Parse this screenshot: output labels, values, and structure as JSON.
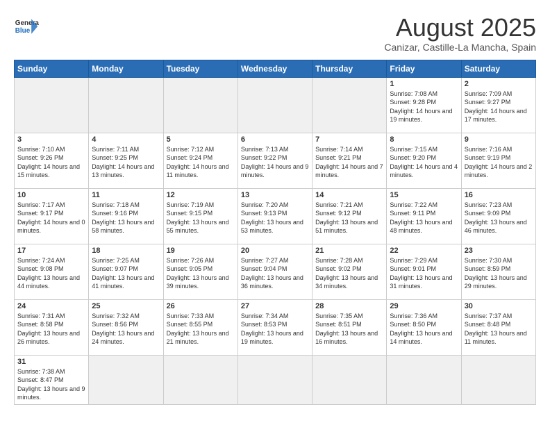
{
  "logo": {
    "text_general": "General",
    "text_blue": "Blue"
  },
  "calendar": {
    "title": "August 2025",
    "subtitle": "Canizar, Castille-La Mancha, Spain",
    "headers": [
      "Sunday",
      "Monday",
      "Tuesday",
      "Wednesday",
      "Thursday",
      "Friday",
      "Saturday"
    ],
    "weeks": [
      [
        {
          "day": "",
          "info": "",
          "empty": true
        },
        {
          "day": "",
          "info": "",
          "empty": true
        },
        {
          "day": "",
          "info": "",
          "empty": true
        },
        {
          "day": "",
          "info": "",
          "empty": true
        },
        {
          "day": "",
          "info": "",
          "empty": true
        },
        {
          "day": "1",
          "info": "Sunrise: 7:08 AM\nSunset: 9:28 PM\nDaylight: 14 hours and 19 minutes."
        },
        {
          "day": "2",
          "info": "Sunrise: 7:09 AM\nSunset: 9:27 PM\nDaylight: 14 hours and 17 minutes."
        }
      ],
      [
        {
          "day": "3",
          "info": "Sunrise: 7:10 AM\nSunset: 9:26 PM\nDaylight: 14 hours and 15 minutes."
        },
        {
          "day": "4",
          "info": "Sunrise: 7:11 AM\nSunset: 9:25 PM\nDaylight: 14 hours and 13 minutes."
        },
        {
          "day": "5",
          "info": "Sunrise: 7:12 AM\nSunset: 9:24 PM\nDaylight: 14 hours and 11 minutes."
        },
        {
          "day": "6",
          "info": "Sunrise: 7:13 AM\nSunset: 9:22 PM\nDaylight: 14 hours and 9 minutes."
        },
        {
          "day": "7",
          "info": "Sunrise: 7:14 AM\nSunset: 9:21 PM\nDaylight: 14 hours and 7 minutes."
        },
        {
          "day": "8",
          "info": "Sunrise: 7:15 AM\nSunset: 9:20 PM\nDaylight: 14 hours and 4 minutes."
        },
        {
          "day": "9",
          "info": "Sunrise: 7:16 AM\nSunset: 9:19 PM\nDaylight: 14 hours and 2 minutes."
        }
      ],
      [
        {
          "day": "10",
          "info": "Sunrise: 7:17 AM\nSunset: 9:17 PM\nDaylight: 14 hours and 0 minutes."
        },
        {
          "day": "11",
          "info": "Sunrise: 7:18 AM\nSunset: 9:16 PM\nDaylight: 13 hours and 58 minutes."
        },
        {
          "day": "12",
          "info": "Sunrise: 7:19 AM\nSunset: 9:15 PM\nDaylight: 13 hours and 55 minutes."
        },
        {
          "day": "13",
          "info": "Sunrise: 7:20 AM\nSunset: 9:13 PM\nDaylight: 13 hours and 53 minutes."
        },
        {
          "day": "14",
          "info": "Sunrise: 7:21 AM\nSunset: 9:12 PM\nDaylight: 13 hours and 51 minutes."
        },
        {
          "day": "15",
          "info": "Sunrise: 7:22 AM\nSunset: 9:11 PM\nDaylight: 13 hours and 48 minutes."
        },
        {
          "day": "16",
          "info": "Sunrise: 7:23 AM\nSunset: 9:09 PM\nDaylight: 13 hours and 46 minutes."
        }
      ],
      [
        {
          "day": "17",
          "info": "Sunrise: 7:24 AM\nSunset: 9:08 PM\nDaylight: 13 hours and 44 minutes."
        },
        {
          "day": "18",
          "info": "Sunrise: 7:25 AM\nSunset: 9:07 PM\nDaylight: 13 hours and 41 minutes."
        },
        {
          "day": "19",
          "info": "Sunrise: 7:26 AM\nSunset: 9:05 PM\nDaylight: 13 hours and 39 minutes."
        },
        {
          "day": "20",
          "info": "Sunrise: 7:27 AM\nSunset: 9:04 PM\nDaylight: 13 hours and 36 minutes."
        },
        {
          "day": "21",
          "info": "Sunrise: 7:28 AM\nSunset: 9:02 PM\nDaylight: 13 hours and 34 minutes."
        },
        {
          "day": "22",
          "info": "Sunrise: 7:29 AM\nSunset: 9:01 PM\nDaylight: 13 hours and 31 minutes."
        },
        {
          "day": "23",
          "info": "Sunrise: 7:30 AM\nSunset: 8:59 PM\nDaylight: 13 hours and 29 minutes."
        }
      ],
      [
        {
          "day": "24",
          "info": "Sunrise: 7:31 AM\nSunset: 8:58 PM\nDaylight: 13 hours and 26 minutes."
        },
        {
          "day": "25",
          "info": "Sunrise: 7:32 AM\nSunset: 8:56 PM\nDaylight: 13 hours and 24 minutes."
        },
        {
          "day": "26",
          "info": "Sunrise: 7:33 AM\nSunset: 8:55 PM\nDaylight: 13 hours and 21 minutes."
        },
        {
          "day": "27",
          "info": "Sunrise: 7:34 AM\nSunset: 8:53 PM\nDaylight: 13 hours and 19 minutes."
        },
        {
          "day": "28",
          "info": "Sunrise: 7:35 AM\nSunset: 8:51 PM\nDaylight: 13 hours and 16 minutes."
        },
        {
          "day": "29",
          "info": "Sunrise: 7:36 AM\nSunset: 8:50 PM\nDaylight: 13 hours and 14 minutes."
        },
        {
          "day": "30",
          "info": "Sunrise: 7:37 AM\nSunset: 8:48 PM\nDaylight: 13 hours and 11 minutes."
        }
      ],
      [
        {
          "day": "31",
          "info": "Sunrise: 7:38 AM\nSunset: 8:47 PM\nDaylight: 13 hours and 9 minutes."
        },
        {
          "day": "",
          "info": "",
          "empty": true
        },
        {
          "day": "",
          "info": "",
          "empty": true
        },
        {
          "day": "",
          "info": "",
          "empty": true
        },
        {
          "day": "",
          "info": "",
          "empty": true
        },
        {
          "day": "",
          "info": "",
          "empty": true
        },
        {
          "day": "",
          "info": "",
          "empty": true
        }
      ]
    ]
  }
}
